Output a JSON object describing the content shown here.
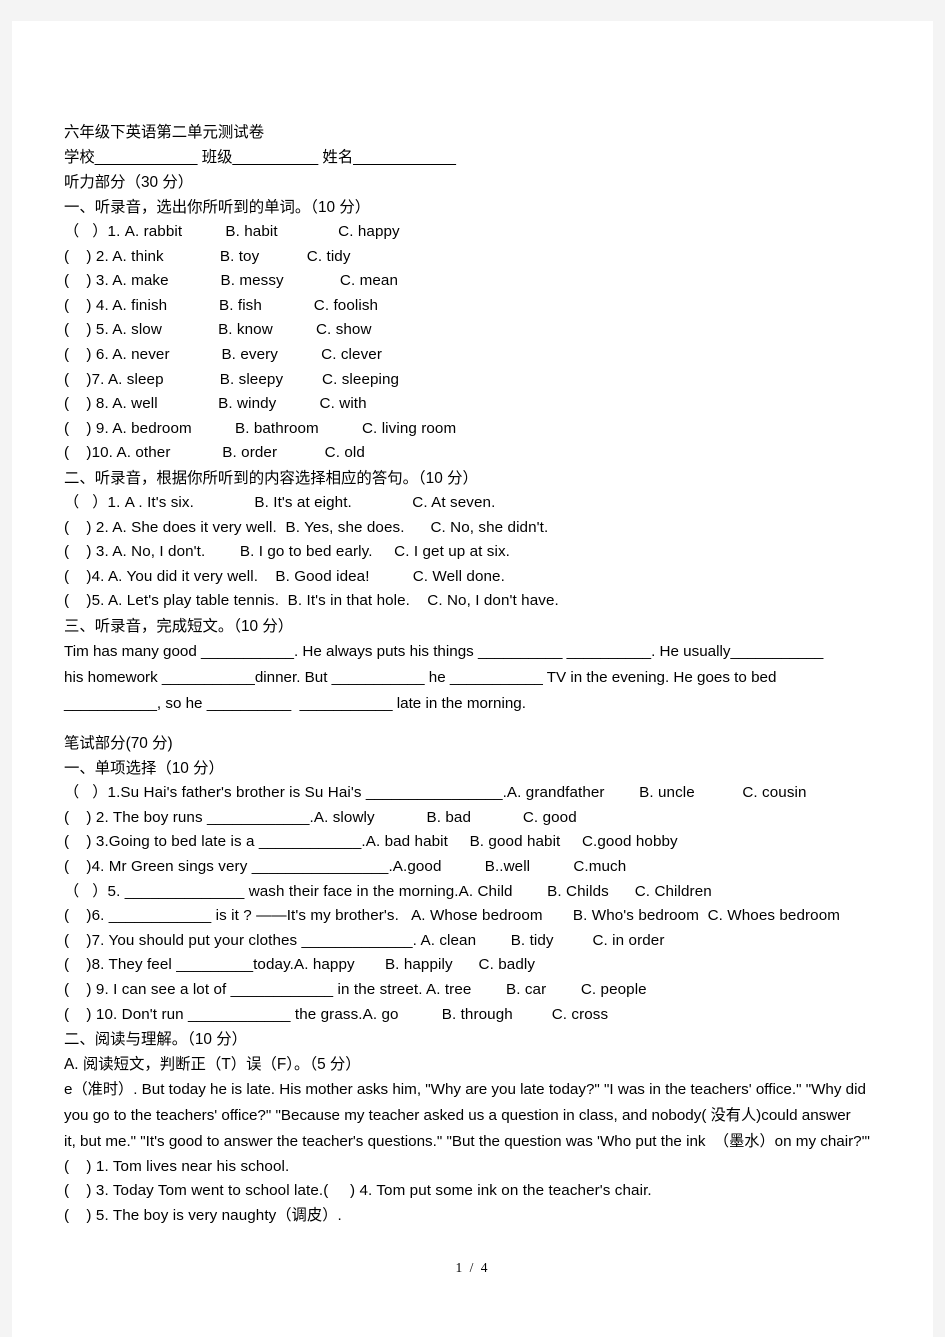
{
  "document": {
    "title": "六年级下英语第二单元测试卷",
    "info_line": "学校____________ 班级__________ 姓名____________",
    "footer": "1 / 4"
  },
  "listening": {
    "section_header": "听力部分（30 分）",
    "part1": {
      "heading": "一、听录音，选出你所听到的单词。（10 分）",
      "items": [
        "（   ）1. A. rabbit          B. habit              C. happy",
        "(    ) 2. A. think             B. toy           C. tidy",
        "(    ) 3. A. make            B. messy             C. mean",
        "(    ) 4. A. finish            B. fish            C. foolish",
        "(    ) 5. A. slow             B. know          C. show",
        "(    ) 6. A. never            B. every          C. clever",
        "(    )7. A. sleep             B. sleepy         C. sleeping",
        "(    ) 8. A. well              B. windy          C. with",
        "(    ) 9. A. bedroom          B. bathroom          C. living room",
        "(    )10. A. other            B. order           C. old"
      ]
    },
    "part2": {
      "heading": "二、听录音，根据你所听到的内容选择相应的答句。（10 分）",
      "items": [
        "（   ）1. A . It's six.              B. It's at eight.              C. At seven.",
        "(    ) 2. A. She does it very well.  B. Yes, she does.      C. No, she didn't.",
        "(    ) 3. A. No, I don't.        B. I go to bed early.     C. I get up at six.",
        "(    )4. A. You did it very well.    B. Good idea!          C. Well done.",
        "(    )5. A. Let's play table tennis.  B. It's in that hole.    C. No, I don't have."
      ]
    },
    "part3": {
      "heading": "三、听录音，完成短文。（10 分）",
      "lines": [
        "Tim has many good ___________. He always puts his things __________ __________. He usually___________",
        "his homework ___________dinner. But ___________ he ___________ TV in the evening. He goes to bed",
        "___________, so he __________  ___________ late in the morning."
      ]
    }
  },
  "written": {
    "section_header": "笔试部分(70 分)",
    "part1": {
      "heading": "一、单项选择（10 分）",
      "items": [
        "（   ）1.Su Hai's father's brother is Su Hai's ________________.A. grandfather        B. uncle           C. cousin",
        "(    ) 2. The boy runs ____________.A. slowly            B. bad            C. good",
        "(    ) 3.Going to bed late is a ____________.A. bad habit     B. good habit     C.good hobby",
        "(    )4. Mr Green sings very ________________.A.good          B..well          C.much",
        "（   ）5. ______________ wash their face in the morning.A. Child        B. Childs      C. Children",
        "(    )6. ____________ is it ? ——It's my brother's.   A. Whose bedroom       B. Who's bedroom  C. Whoes bedroom",
        "(    )7. You should put your clothes _____________. A. clean        B. tidy         C. in order",
        "(    )8. They feel _________today.A. happy       B. happily      C. badly",
        "(    ) 9. I can see a lot of ____________ in the street. A. tree        B. car        C. people",
        "(    ) 10. Don't run ____________ the grass.A. go          B. through         C. cross"
      ]
    },
    "part2": {
      "heading": "二、阅读与理解。（10 分）",
      "subheading": "A. 阅读短文，判断正（T）误（F）。（5 分）",
      "passage": [
        "e（准时）. But today he is late. His mother asks him, \"Why are you late today?\" \"I was in the teachers' office.\" \"Why did",
        "you go to the teachers' office?\" \"Because my teacher asked us a question in class, and nobody( 没有人)could answer",
        "it, but me.\" \"It's good to answer the teacher's questions.\" \"But the question was 'Who put the ink  （墨水）on my chair?'\""
      ],
      "statements": [
        "(    ) 1. Tom lives near his school.",
        "(    ) 3. Today Tom went to school late.(     ) 4. Tom put some ink on the teacher's chair.",
        "(    ) 5. The boy is very naughty（调皮）."
      ]
    }
  }
}
